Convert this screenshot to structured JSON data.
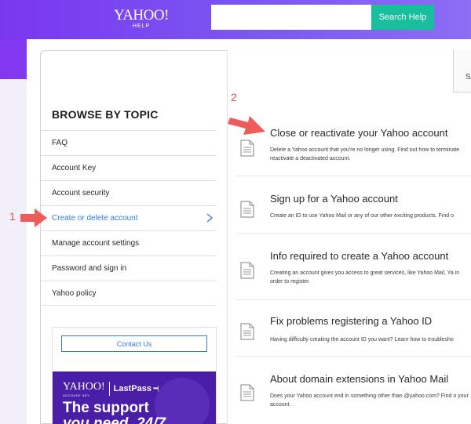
{
  "header": {
    "logo_main": "YAHOO!",
    "logo_sub": "HELP",
    "search_placeholder": "",
    "search_button": "Search Help"
  },
  "sidebar": {
    "title": "BROWSE BY TOPIC",
    "items": [
      {
        "label": "FAQ",
        "active": false
      },
      {
        "label": "Account Key",
        "active": false
      },
      {
        "label": "Account security",
        "active": false
      },
      {
        "label": "Create or delete account",
        "active": true
      },
      {
        "label": "Manage account settings",
        "active": false
      },
      {
        "label": "Password and sign in",
        "active": false
      },
      {
        "label": "Yahoo policy",
        "active": false
      }
    ],
    "contact_button": "Contact Us"
  },
  "ad": {
    "yahoo": "YAHOO!",
    "yahoo_sub": "ACCOUNT KEY",
    "lastpass": "LastPass",
    "lastpass_dots": "•••|",
    "headline1": "The support",
    "headline2": "you need, 24/7"
  },
  "corner": {
    "text": "S"
  },
  "articles": [
    {
      "title": "Close or reactivate your Yahoo account",
      "desc": "Delete a Yahoo account that you're no longer using. Find out how to terminate reactivate a deactivated account."
    },
    {
      "title": "Sign up for a Yahoo account",
      "desc": "Create an ID to use Yahoo Mail or any of our other exciting products. Find o"
    },
    {
      "title": "Info required to create a Yahoo account",
      "desc": "Creating an account gives you access to great services, like Yahoo Mail, Ya in order to register."
    },
    {
      "title": "Fix problems registering a Yahoo ID",
      "desc": "Having difficulty creating the account ID you want? Learn how to troublesho"
    },
    {
      "title": "About domain extensions in Yahoo Mail",
      "desc": "Does your Yahoo account end in something other than @yahoo.com? Find o your account."
    }
  ],
  "annotations": {
    "one": "1",
    "two": "2"
  },
  "colors": {
    "header_purple": "#7b55f1",
    "search_green": "#18bf9f",
    "link_blue": "#3a7bd5",
    "annotation_red": "#e05050",
    "ad_purple": "#4b1ea8"
  }
}
